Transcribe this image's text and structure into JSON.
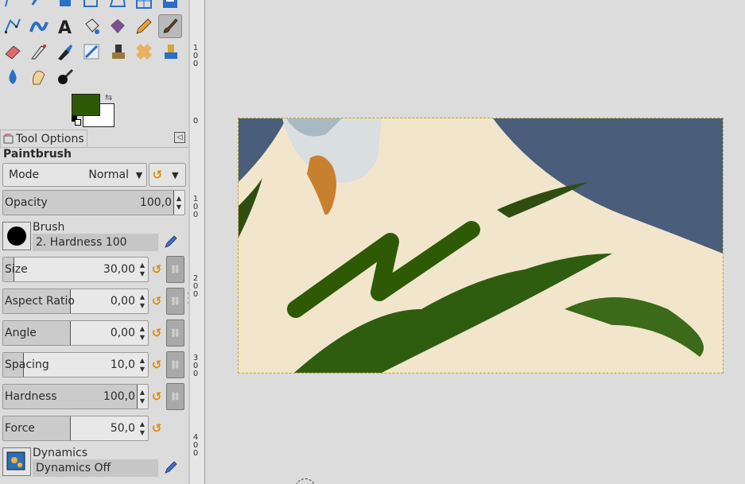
{
  "toolbox": {
    "tools": [
      {
        "name": "free-select-tool-icon",
        "row": 0,
        "col": 0
      },
      {
        "name": "smudge-tool-icon",
        "row": 0,
        "col": 1
      },
      {
        "name": "crop-tool-icon",
        "row": 0,
        "col": 2
      },
      {
        "name": "transform-tool-icon",
        "row": 0,
        "col": 3
      },
      {
        "name": "perspective-tool-icon",
        "row": 0,
        "col": 4
      },
      {
        "name": "cage-tool-icon",
        "row": 0,
        "col": 5
      },
      {
        "name": "flip-tool-icon",
        "row": 0,
        "col": 6
      },
      {
        "name": "paths-tool-icon",
        "row": 1,
        "col": 0
      },
      {
        "name": "warp-transform-icon",
        "row": 1,
        "col": 1
      },
      {
        "name": "text-tool-icon",
        "row": 1,
        "col": 2
      },
      {
        "name": "bucket-fill-icon",
        "row": 1,
        "col": 3
      },
      {
        "name": "gradient-tool-icon",
        "row": 1,
        "col": 4
      },
      {
        "name": "pencil-tool-icon",
        "row": 1,
        "col": 5
      },
      {
        "name": "paintbrush-tool-icon",
        "row": 1,
        "col": 6,
        "active": true
      },
      {
        "name": "eraser-tool-icon",
        "row": 2,
        "col": 0
      },
      {
        "name": "airbrush-tool-icon",
        "row": 2,
        "col": 1
      },
      {
        "name": "ink-tool-icon",
        "row": 2,
        "col": 2
      },
      {
        "name": "mypaint-brush-icon",
        "row": 2,
        "col": 3
      },
      {
        "name": "clone-tool-icon",
        "row": 2,
        "col": 4
      },
      {
        "name": "heal-tool-icon",
        "row": 2,
        "col": 5
      },
      {
        "name": "perspective-clone-icon",
        "row": 2,
        "col": 6
      },
      {
        "name": "blur-sharpen-icon",
        "row": 3,
        "col": 0
      },
      {
        "name": "smudge-hand-icon",
        "row": 3,
        "col": 1
      },
      {
        "name": "dodge-burn-icon",
        "row": 3,
        "col": 2
      }
    ]
  },
  "colors": {
    "foreground": "#2f5a05",
    "background": "#ffffff",
    "accent_reset": "#e08a00"
  },
  "tab": {
    "label": "Tool Options"
  },
  "tool_options": {
    "title": "Paintbrush",
    "mode": {
      "label": "Mode",
      "value": "Normal"
    },
    "opacity": {
      "label": "Opacity",
      "value": "100,0",
      "fraction": 1.0
    },
    "brush": {
      "label": "Brush",
      "name": "2. Hardness 100"
    },
    "size": {
      "label": "Size",
      "value": "30,00",
      "fraction": 0.08
    },
    "aspect_ratio": {
      "label": "Aspect Ratio",
      "value": "0,00",
      "fraction": 0.5
    },
    "angle": {
      "label": "Angle",
      "value": "0,00",
      "fraction": 0.5
    },
    "spacing": {
      "label": "Spacing",
      "value": "10,0",
      "fraction": 0.15
    },
    "hardness": {
      "label": "Hardness",
      "value": "100,0",
      "fraction": 1.0
    },
    "force": {
      "label": "Force",
      "value": "50,0",
      "fraction": 0.5
    },
    "dynamics": {
      "label": "Dynamics",
      "name": "Dynamics Off"
    }
  },
  "ruler": {
    "labels": [
      "1\n0\n0",
      "0",
      "1\n0\n0",
      "2\n0\n0",
      "3\n0\n0",
      "4\n0\n0"
    ]
  }
}
